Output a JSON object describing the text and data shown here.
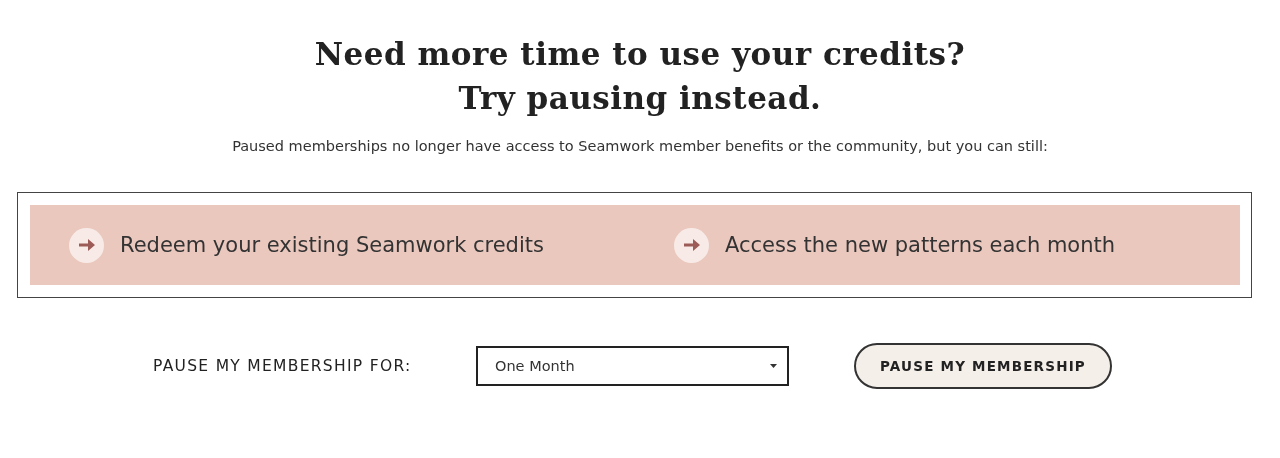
{
  "heading": [
    "Need more time to use your credits?",
    "Try pausing instead."
  ],
  "intro": "Paused memberships no longer have access to Seamwork member benefits or the community, but you can still:",
  "benefits": [
    "Redeem your existing Seamwork credits",
    "Access the new patterns each month"
  ],
  "pause_form": {
    "label": "PAUSE MY MEMBERSHIP FOR:",
    "duration": "One Month",
    "button": "PAUSE MY MEMBERSHIP"
  }
}
